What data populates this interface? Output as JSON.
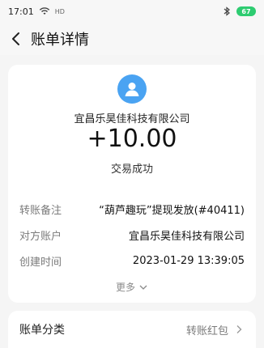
{
  "status_bar": {
    "time": "17:01",
    "network_tag": "HD",
    "battery": "67"
  },
  "header": {
    "title": "账单详情"
  },
  "transaction": {
    "merchant": "宜昌乐昊佳科技有限公司",
    "amount": "+10.00",
    "status": "交易成功"
  },
  "details": [
    {
      "label": "转账备注",
      "value": "“葫芦趣玩”提现发放(#40411)"
    },
    {
      "label": "对方账户",
      "value": "宜昌乐昊佳科技有限公司"
    },
    {
      "label": "创建时间",
      "value": "2023-01-29 13:39:05"
    }
  ],
  "more_label": "更多",
  "category": {
    "label": "账单分类",
    "value": "转账红包"
  },
  "colors": {
    "accent_blue": "#4aa3f2",
    "battery_green": "#2ecc71",
    "background": "#f5f5f5"
  }
}
